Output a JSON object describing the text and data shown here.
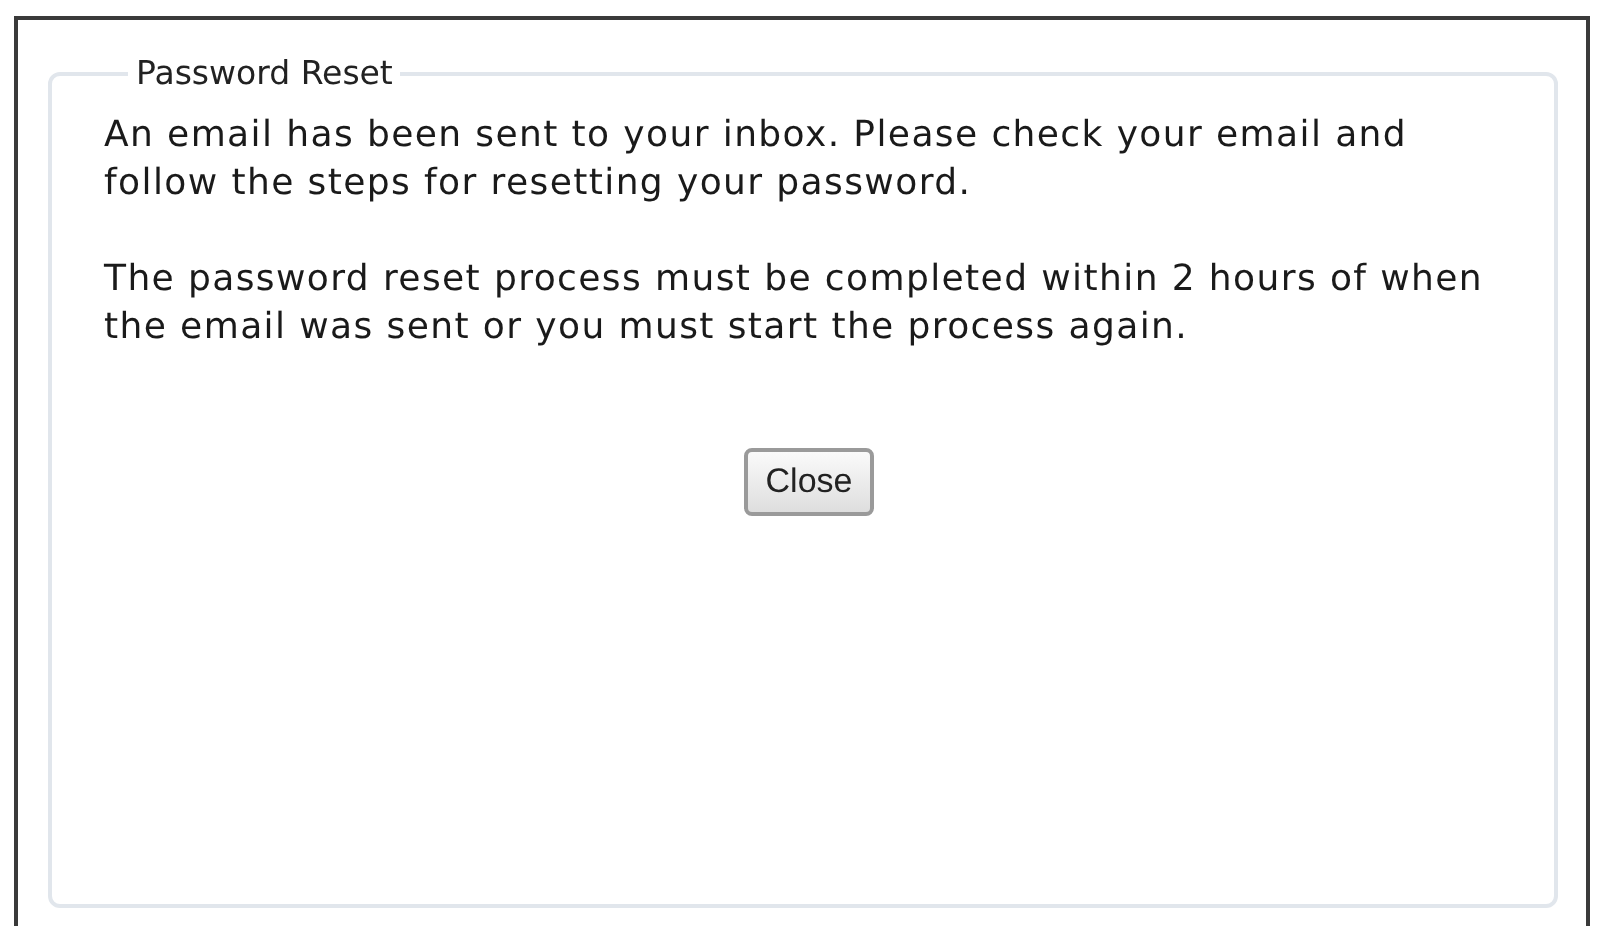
{
  "panel": {
    "legend": "Password Reset",
    "paragraphs": [
      "An email has been sent to your inbox. Please check your email and follow the steps for resetting your password.",
      "The password reset process must be completed within 2 hours of when the email was sent or you must start the process again."
    ],
    "buttons": [
      "Close"
    ]
  }
}
